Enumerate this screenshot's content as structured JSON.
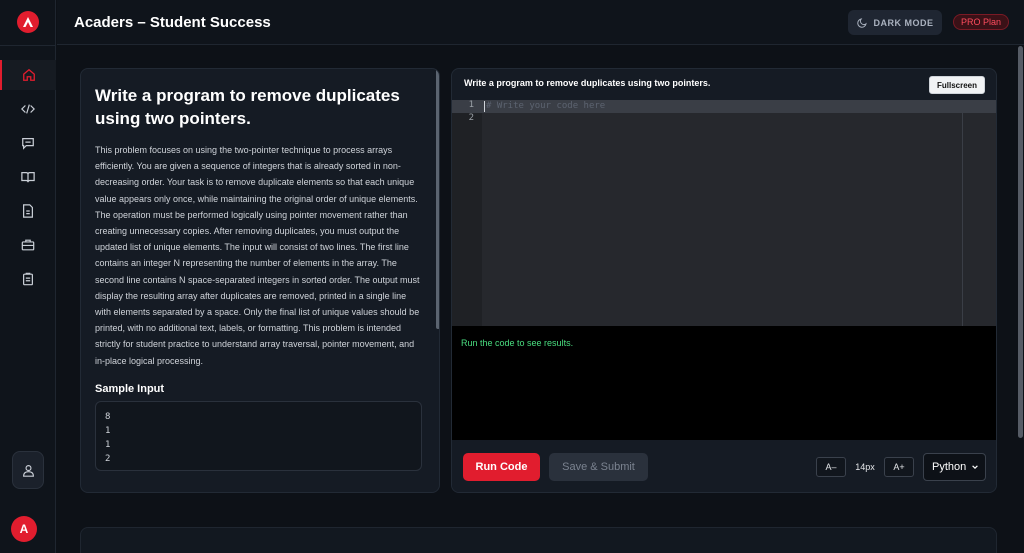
{
  "header": {
    "title": "Acaders – Student Success",
    "dark_mode_label": "DARK MODE",
    "plan_badge": "PRO Plan"
  },
  "sidebar": {
    "items": [
      {
        "icon": "home-icon",
        "active": true
      },
      {
        "icon": "code-icon",
        "active": false
      },
      {
        "icon": "chat-icon",
        "active": false
      },
      {
        "icon": "book-icon",
        "active": false
      },
      {
        "icon": "document-icon",
        "active": false
      },
      {
        "icon": "briefcase-icon",
        "active": false
      },
      {
        "icon": "clipboard-icon",
        "active": false
      }
    ],
    "avatar_initial": "A"
  },
  "problem": {
    "title": "Write a program to remove duplicates using two pointers.",
    "description": "This problem focuses on using the two-pointer technique to process arrays efficiently. You are given a sequence of integers that is already sorted in non-decreasing order. Your task is to remove duplicate elements so that each unique value appears only once, while maintaining the original order of unique elements. The operation must be performed logically using pointer movement rather than creating unnecessary copies. After removing duplicates, you must output the updated list of unique elements. The input will consist of two lines. The first line contains an integer N representing the number of elements in the array. The second line contains N space-separated integers in sorted order. The output must display the resulting array after duplicates are removed, printed in a single line with elements separated by a space. Only the final list of unique values should be printed, with no additional text, labels, or formatting. This problem is intended strictly for student practice to understand array traversal, pointer movement, and in-place logical processing.",
    "sample_input_label": "Sample Input",
    "sample_input_lines": [
      "8",
      "1",
      "1",
      "2"
    ]
  },
  "editor": {
    "title": "Write a program to remove duplicates using two pointers.",
    "fullscreen_label": "Fullscreen",
    "line_numbers": [
      "1",
      "2"
    ],
    "placeholder": "# Write your code here",
    "output_text": "Run the code to see results.",
    "run_label": "Run Code",
    "submit_label": "Save & Submit",
    "font_decrease_label": "A–",
    "font_size": "14px",
    "font_increase_label": "A+",
    "language": "Python"
  },
  "colors": {
    "accent": "#e11d2e",
    "output_success": "#4ade80",
    "background": "#0d1117"
  }
}
